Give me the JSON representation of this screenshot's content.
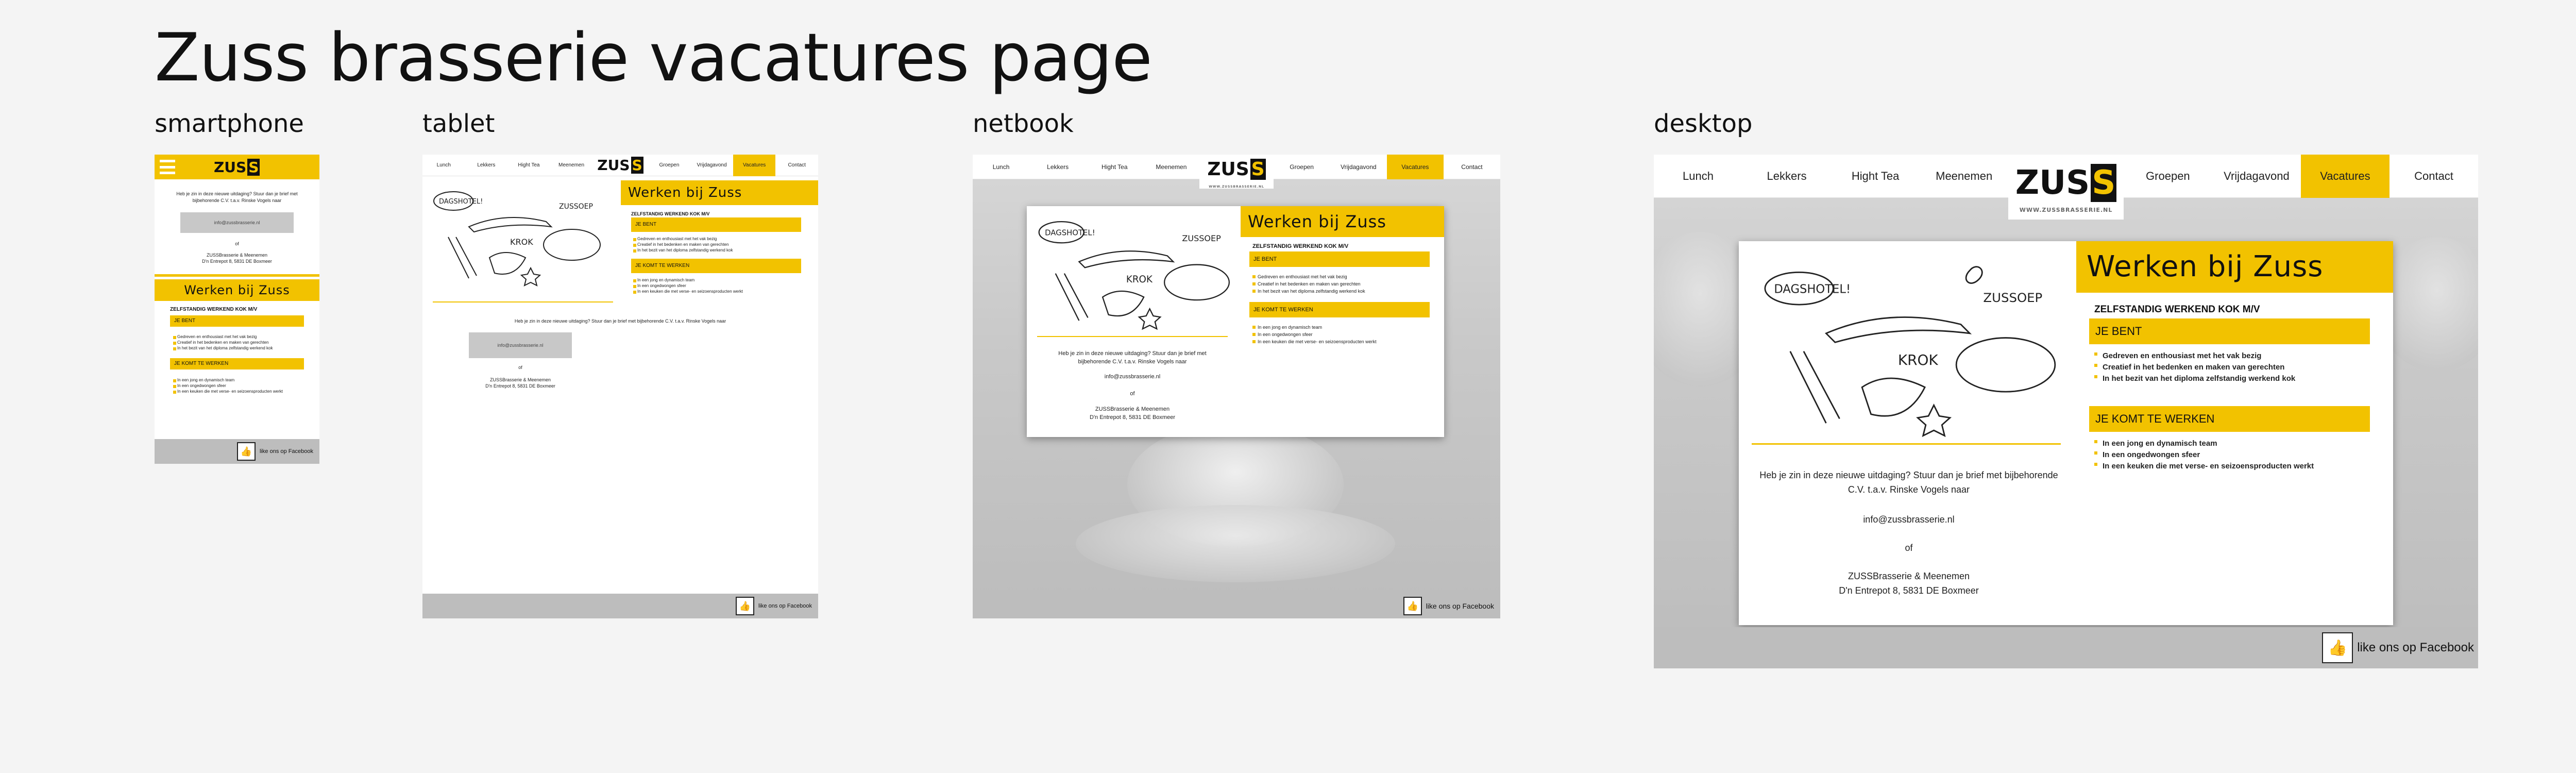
{
  "page": {
    "title": "Zuss brasserie vacatures page"
  },
  "devices": {
    "smartphone": "smartphone",
    "tablet": "tablet",
    "netbook": "netbook",
    "desktop": "desktop"
  },
  "nav": {
    "items": [
      "Lunch",
      "Lekkers",
      "Hight Tea",
      "Meenemen",
      "Groepen",
      "Vrijdagavond",
      "Vacatures",
      "Contact"
    ],
    "active": "Vacatures"
  },
  "logo": {
    "text": "ZUS",
    "box": "S",
    "sub": "WWW.ZUSSBRASSERIE.NL"
  },
  "content": {
    "heading": "Werken bij Zuss",
    "job_title": "ZELFSTANDIG WERKEND KOK M/V",
    "section1_title": "JE BENT",
    "section1_items": [
      "Gedreven en enthousiast met het vak bezig",
      "Creatief in het bedenken en maken van gerechten",
      "In het bezit van het diploma zelfstandig werkend kok"
    ],
    "section2_title": "JE KOMT TE WERKEN",
    "section2_items": [
      "In een jong en dynamisch team",
      "In een ongedwongen sfeer",
      "In een keuken die met verse- en seizoensproducten werkt"
    ],
    "invite": "Heb je zin in deze nieuwe uitdaging? Stuur dan je brief met bijbehorende C.V. t.a.v. Rinske Vogels naar",
    "email": "info@zussbrasserie.nl",
    "of": "of",
    "company": "ZUSSBrasserie & Meenemen",
    "address": "D'n Entrepot 8, 5831 DE Boxmeer"
  },
  "doodle": {
    "dagschotel": "DAGSHOTEL!",
    "krok": "KROK",
    "zussoep": "ZUSSOEP"
  },
  "footer": {
    "facebook": "like ons op Facebook"
  },
  "colors": {
    "accent": "#f2c200",
    "footer": "#bdbdbd",
    "background": "#f4f4f4"
  }
}
